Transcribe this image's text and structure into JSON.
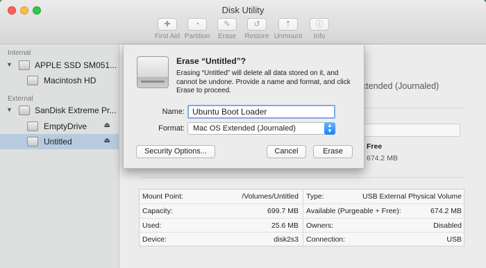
{
  "window": {
    "title": "Disk Utility"
  },
  "toolbar": {
    "items": [
      {
        "label": "First Aid",
        "icon": "stethoscope-icon",
        "glyph": "✚"
      },
      {
        "label": "Partition",
        "icon": "partition-icon",
        "glyph": "◔"
      },
      {
        "label": "Erase",
        "icon": "erase-icon",
        "glyph": "✎"
      },
      {
        "label": "Restore",
        "icon": "restore-icon",
        "glyph": "↺"
      },
      {
        "label": "Unmount",
        "icon": "unmount-icon",
        "glyph": "⇡"
      },
      {
        "label": "Info",
        "icon": "info-icon",
        "glyph": "ⓘ"
      }
    ]
  },
  "sidebar": {
    "internal_header": "Internal",
    "external_header": "External",
    "internal_disk": "APPLE SSD SM051...",
    "internal_volume": "Macintosh HD",
    "external_disk": "SanDisk Extreme Pr...",
    "external_volume_1": "EmptyDrive",
    "external_volume_2": "Untitled",
    "eject_glyph": "⏏"
  },
  "background": {
    "format_text": "xtended (Journaled)",
    "free_label": "Free",
    "free_value": "674.2 MB"
  },
  "info_table": {
    "left": [
      {
        "key": "Mount Point:",
        "value": "/Volumes/Untitled"
      },
      {
        "key": "Capacity:",
        "value": "699.7 MB"
      },
      {
        "key": "Used:",
        "value": "25.6 MB"
      },
      {
        "key": "Device:",
        "value": "disk2s3"
      }
    ],
    "right": [
      {
        "key": "Type:",
        "value": "USB External Physical Volume"
      },
      {
        "key": "Available (Purgeable + Free):",
        "value": "674.2 MB"
      },
      {
        "key": "Owners:",
        "value": "Disabled"
      },
      {
        "key": "Connection:",
        "value": "USB"
      }
    ]
  },
  "sheet": {
    "title": "Erase “Untitled”?",
    "message": "Erasing “Untitled” will delete all data stored on it, and cannot be undone. Provide a name and format, and click Erase to proceed.",
    "name_label": "Name:",
    "name_value": "Ubuntu Boot Loader",
    "format_label": "Format:",
    "format_value": "Mac OS Extended (Journaled)",
    "security_button": "Security Options...",
    "cancel_button": "Cancel",
    "erase_button": "Erase"
  },
  "colors": {
    "selection": "#b7cbe0",
    "focus_ring": "#7fa9e6",
    "popup_accent": "#1a82fb"
  }
}
